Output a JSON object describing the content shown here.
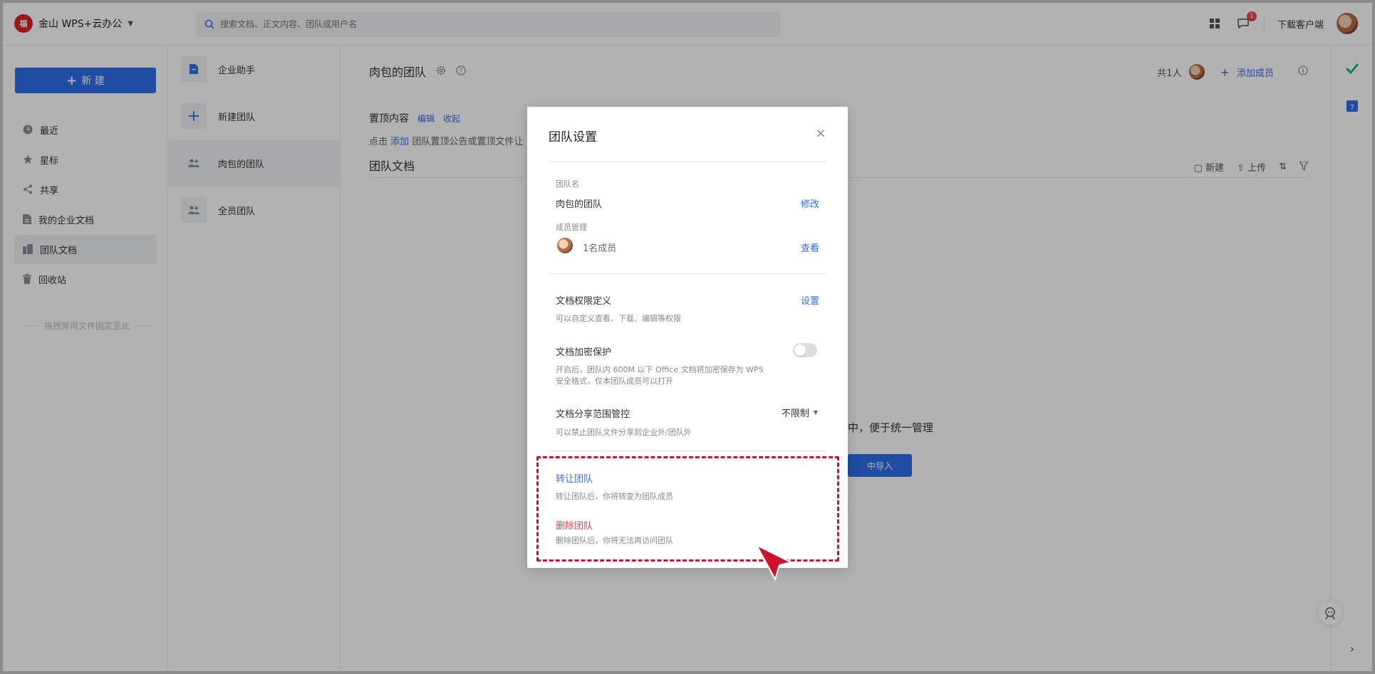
{
  "brand": {
    "logo_text": "福",
    "name": "金山 WPS+云办公"
  },
  "search": {
    "placeholder": "搜索文档、正文内容、团队或用户名"
  },
  "topbar": {
    "notification_count": "1",
    "download_label": "下载客户端"
  },
  "sidebar": {
    "new_label": "新 建",
    "items": [
      {
        "label": "最近",
        "icon": "clock-icon"
      },
      {
        "label": "星标",
        "icon": "star-icon"
      },
      {
        "label": "共享",
        "icon": "share-icon"
      },
      {
        "label": "我的企业文档",
        "icon": "document-icon"
      },
      {
        "label": "团队文档",
        "icon": "building-icon"
      },
      {
        "label": "回收站",
        "icon": "trash-icon"
      }
    ],
    "pin_hint": "拖拽常用文件固定至此"
  },
  "teams": {
    "items": [
      {
        "label": "企业助手",
        "icon": "assistant-icon"
      },
      {
        "label": "新建团队",
        "icon": "plus-icon"
      },
      {
        "label": "肉包的团队",
        "icon": "team-icon"
      },
      {
        "label": "全员团队",
        "icon": "team-icon"
      }
    ]
  },
  "main": {
    "title": "肉包的团队",
    "member_total": "共1人",
    "add_member": "添加成员",
    "pinned_title": "置顶内容",
    "pinned_edit": "编辑",
    "pinned_collapse": "收起",
    "pinned_desc_prefix": "点击",
    "pinned_desc_link": "添加",
    "pinned_desc_suffix": "团队置顶公告或置顶文件让",
    "docs_title": "团队文档",
    "tool_new": "新建",
    "tool_upload": "上传",
    "empty_text": "中，便于统一管理",
    "import_label": "中导入"
  },
  "dialog": {
    "title": "团队设置",
    "team_name_label": "团队名",
    "team_name": "肉包的团队",
    "modify": "修改",
    "member_label": "成员管理",
    "member_count": "1名成员",
    "view": "查看",
    "perm_title": "文档权限定义",
    "perm_action": "设置",
    "perm_desc": "可以自定义查看、下载、编辑等权限",
    "encrypt_title": "文档加密保护",
    "encrypt_desc_line1": "开启后，团队内 600M 以下 Office 文档将加密保存为 WPS",
    "encrypt_desc_line2": "安全格式，仅本团队成员可以打开",
    "share_title": "文档分享范围管控",
    "share_value": "不限制",
    "share_desc": "可以禁止团队文件分享到企业外/团队外",
    "transfer_title": "转让团队",
    "transfer_desc": "转让团队后，你将转变为团队成员",
    "delete_title": "删除团队",
    "delete_desc": "删除团队后，你将无法再访问团队"
  },
  "colors": {
    "accent": "#2f6ee8",
    "danger": "#e0404a",
    "highlight": "#d1102a"
  }
}
